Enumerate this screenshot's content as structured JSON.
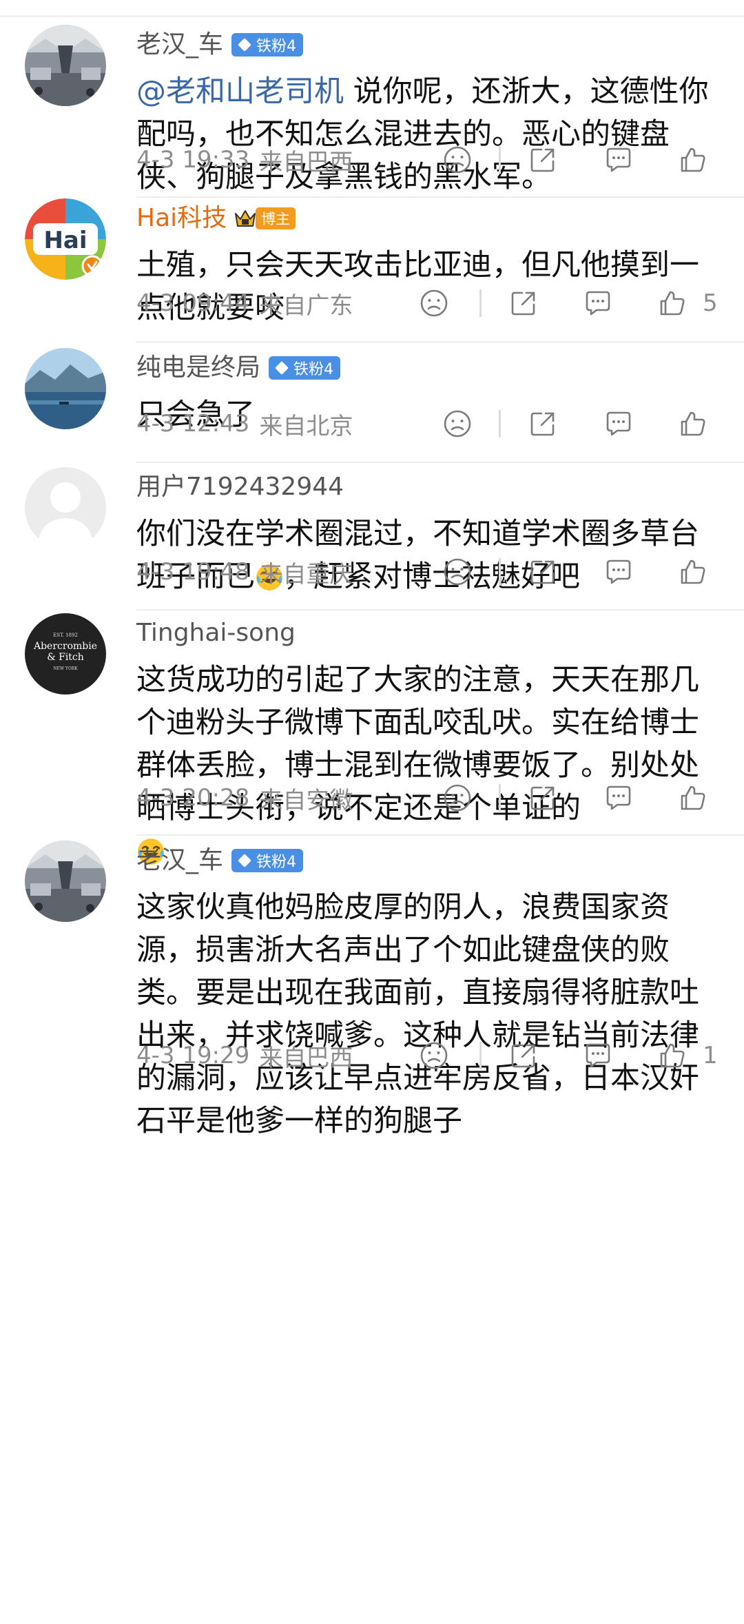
{
  "comments": [
    {
      "user": "老汉_车",
      "badge": "铁粉4",
      "mention": "@老和山老司机",
      "text": "说你呢，还浙大，这德性你配吗，也不知怎么混进去的。恶心的键盘侠、狗腿子及拿黑钱的黑水军。",
      "time": "4-3 19:33",
      "location": "来自巴西",
      "likes": ""
    },
    {
      "user": "Hai科技",
      "badge_label": "博主",
      "avatar_text": "Hai",
      "text": "土殖，只会天天攻击比亚迪，但凡他摸到一点他就要咬",
      "time": "4-3 09:44",
      "location": "来自广东",
      "likes": "5"
    },
    {
      "user": "纯电是终局",
      "badge": "铁粉4",
      "text": "只会急了",
      "time": "4-3 12:43",
      "location": "来自北京",
      "likes": ""
    },
    {
      "user": "用户7192432944",
      "text_a": "你们没在学术圈混过，不知道学术圈多草台班子而已",
      "text_b": "，赶紧对博士祛魅好吧",
      "time": "4-3 19:48",
      "location": "来自重庆",
      "likes": ""
    },
    {
      "user": "Tinghai-song",
      "avatar_text": [
        "EST. 1892",
        "Abercrombie",
        "& Fitch",
        "NEW YORK"
      ],
      "text": "这货成功的引起了大家的注意，天天在那几个迪粉头子微博下面乱咬乱吠。实在给博士群体丢脸，博士混到在微博要饭了。别处处晒博士头衔，说不定还是个单证的",
      "time": "4-3 20:28",
      "location": "来自安徽",
      "likes": ""
    },
    {
      "user": "老汉_车",
      "badge": "铁粉4",
      "text": "这家伙真他妈脸皮厚的阴人，浪费国家资源，损害浙大名声出了个如此键盘侠的败类。要是出现在我面前，直接扇得将脏款吐出来，并求饶喊爹。这种人就是钻当前法律的漏洞，应该让早点进牢房反省，日本汉奸石平是他爹一样的狗腿子",
      "time": "4-3 19:29",
      "location": "来自巴西",
      "likes": "1"
    }
  ],
  "icons": {
    "dislike": "frown-icon",
    "repost": "share-icon",
    "reply": "comment-bubble-icon",
    "like": "thumbs-up-icon",
    "badge": "diamond-icon",
    "bozhu": "crown-icon",
    "emoji": "laugh-cry-emoji-icon"
  },
  "colors": {
    "mention": "#3868a8",
    "badge": "#4a8fe6",
    "vip_name": "#e86a10",
    "meta": "#8d8d8d"
  }
}
